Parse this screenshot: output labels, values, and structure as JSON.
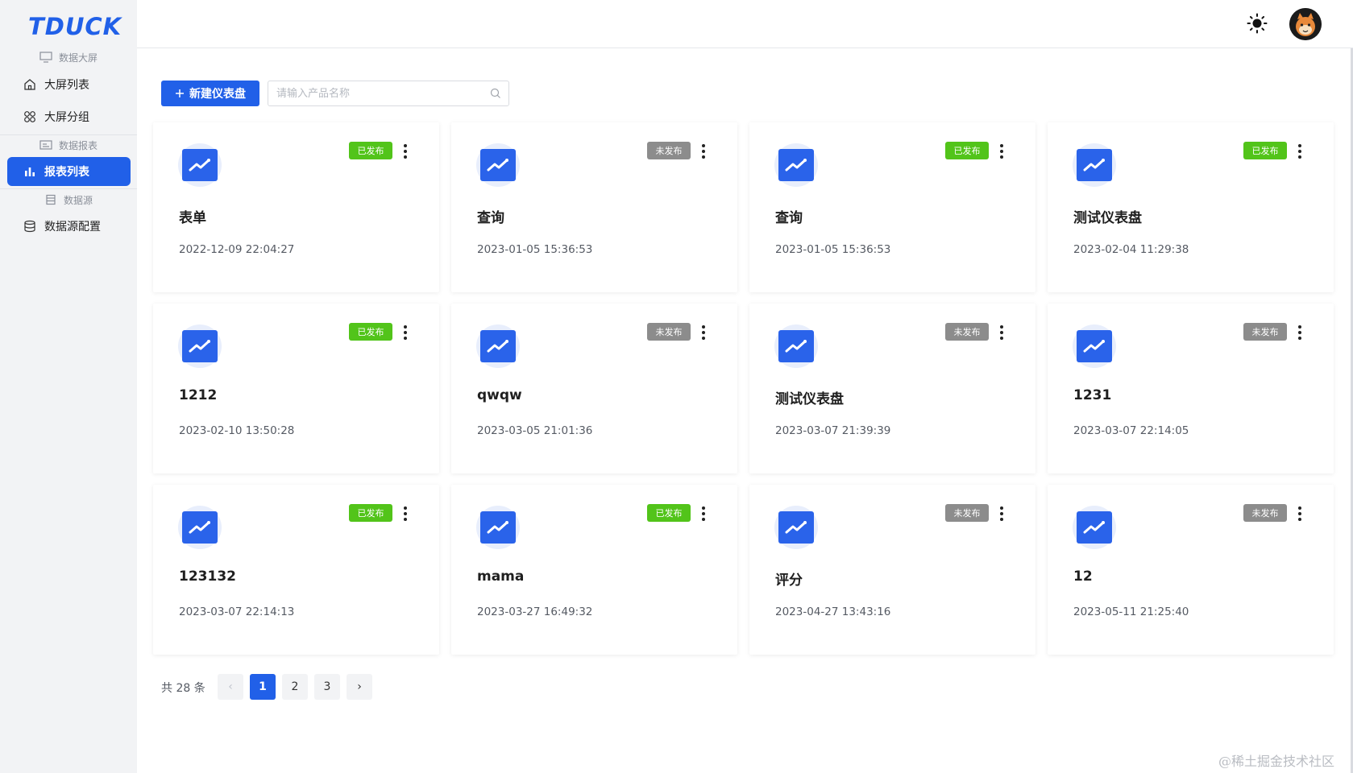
{
  "brand": {
    "logo": "TDUCK"
  },
  "sidebar": {
    "group_screen": "数据大屏",
    "item_screen_list": "大屏列表",
    "item_screen_group": "大屏分组",
    "group_report": "数据报表",
    "item_report_list": "报表列表",
    "group_datasource": "数据源",
    "item_datasource_config": "数据源配置"
  },
  "toolbar": {
    "new_button": "新建仪表盘",
    "search_placeholder": "请输入产品名称"
  },
  "cards": [
    {
      "title": "表单",
      "time": "2022-12-09 22:04:27",
      "status": "已发布"
    },
    {
      "title": "查询",
      "time": "2023-01-05 15:36:53",
      "status": "未发布"
    },
    {
      "title": "查询",
      "time": "2023-01-05 15:36:53",
      "status": "已发布"
    },
    {
      "title": "测试仪表盘",
      "time": "2023-02-04 11:29:38",
      "status": "已发布"
    },
    {
      "title": "1212",
      "time": "2023-02-10 13:50:28",
      "status": "已发布"
    },
    {
      "title": "qwqw",
      "time": "2023-03-05 21:01:36",
      "status": "未发布"
    },
    {
      "title": "测试仪表盘",
      "time": "2023-03-07 21:39:39",
      "status": "未发布"
    },
    {
      "title": "1231",
      "time": "2023-03-07 22:14:05",
      "status": "未发布"
    },
    {
      "title": "123132",
      "time": "2023-03-07 22:14:13",
      "status": "已发布"
    },
    {
      "title": "mama",
      "time": "2023-03-27 16:49:32",
      "status": "已发布"
    },
    {
      "title": "评分",
      "time": "2023-04-27 13:43:16",
      "status": "未发布"
    },
    {
      "title": "12",
      "time": "2023-05-11 21:25:40",
      "status": "未发布"
    }
  ],
  "status_colors": {
    "已发布": "#52c41a",
    "未发布": "#8c8c8c"
  },
  "pagination": {
    "total": "共 28 条",
    "pages": [
      "1",
      "2",
      "3"
    ],
    "current": "1",
    "prev": "‹",
    "next": "›"
  },
  "watermark": "@稀土掘金技术社区"
}
